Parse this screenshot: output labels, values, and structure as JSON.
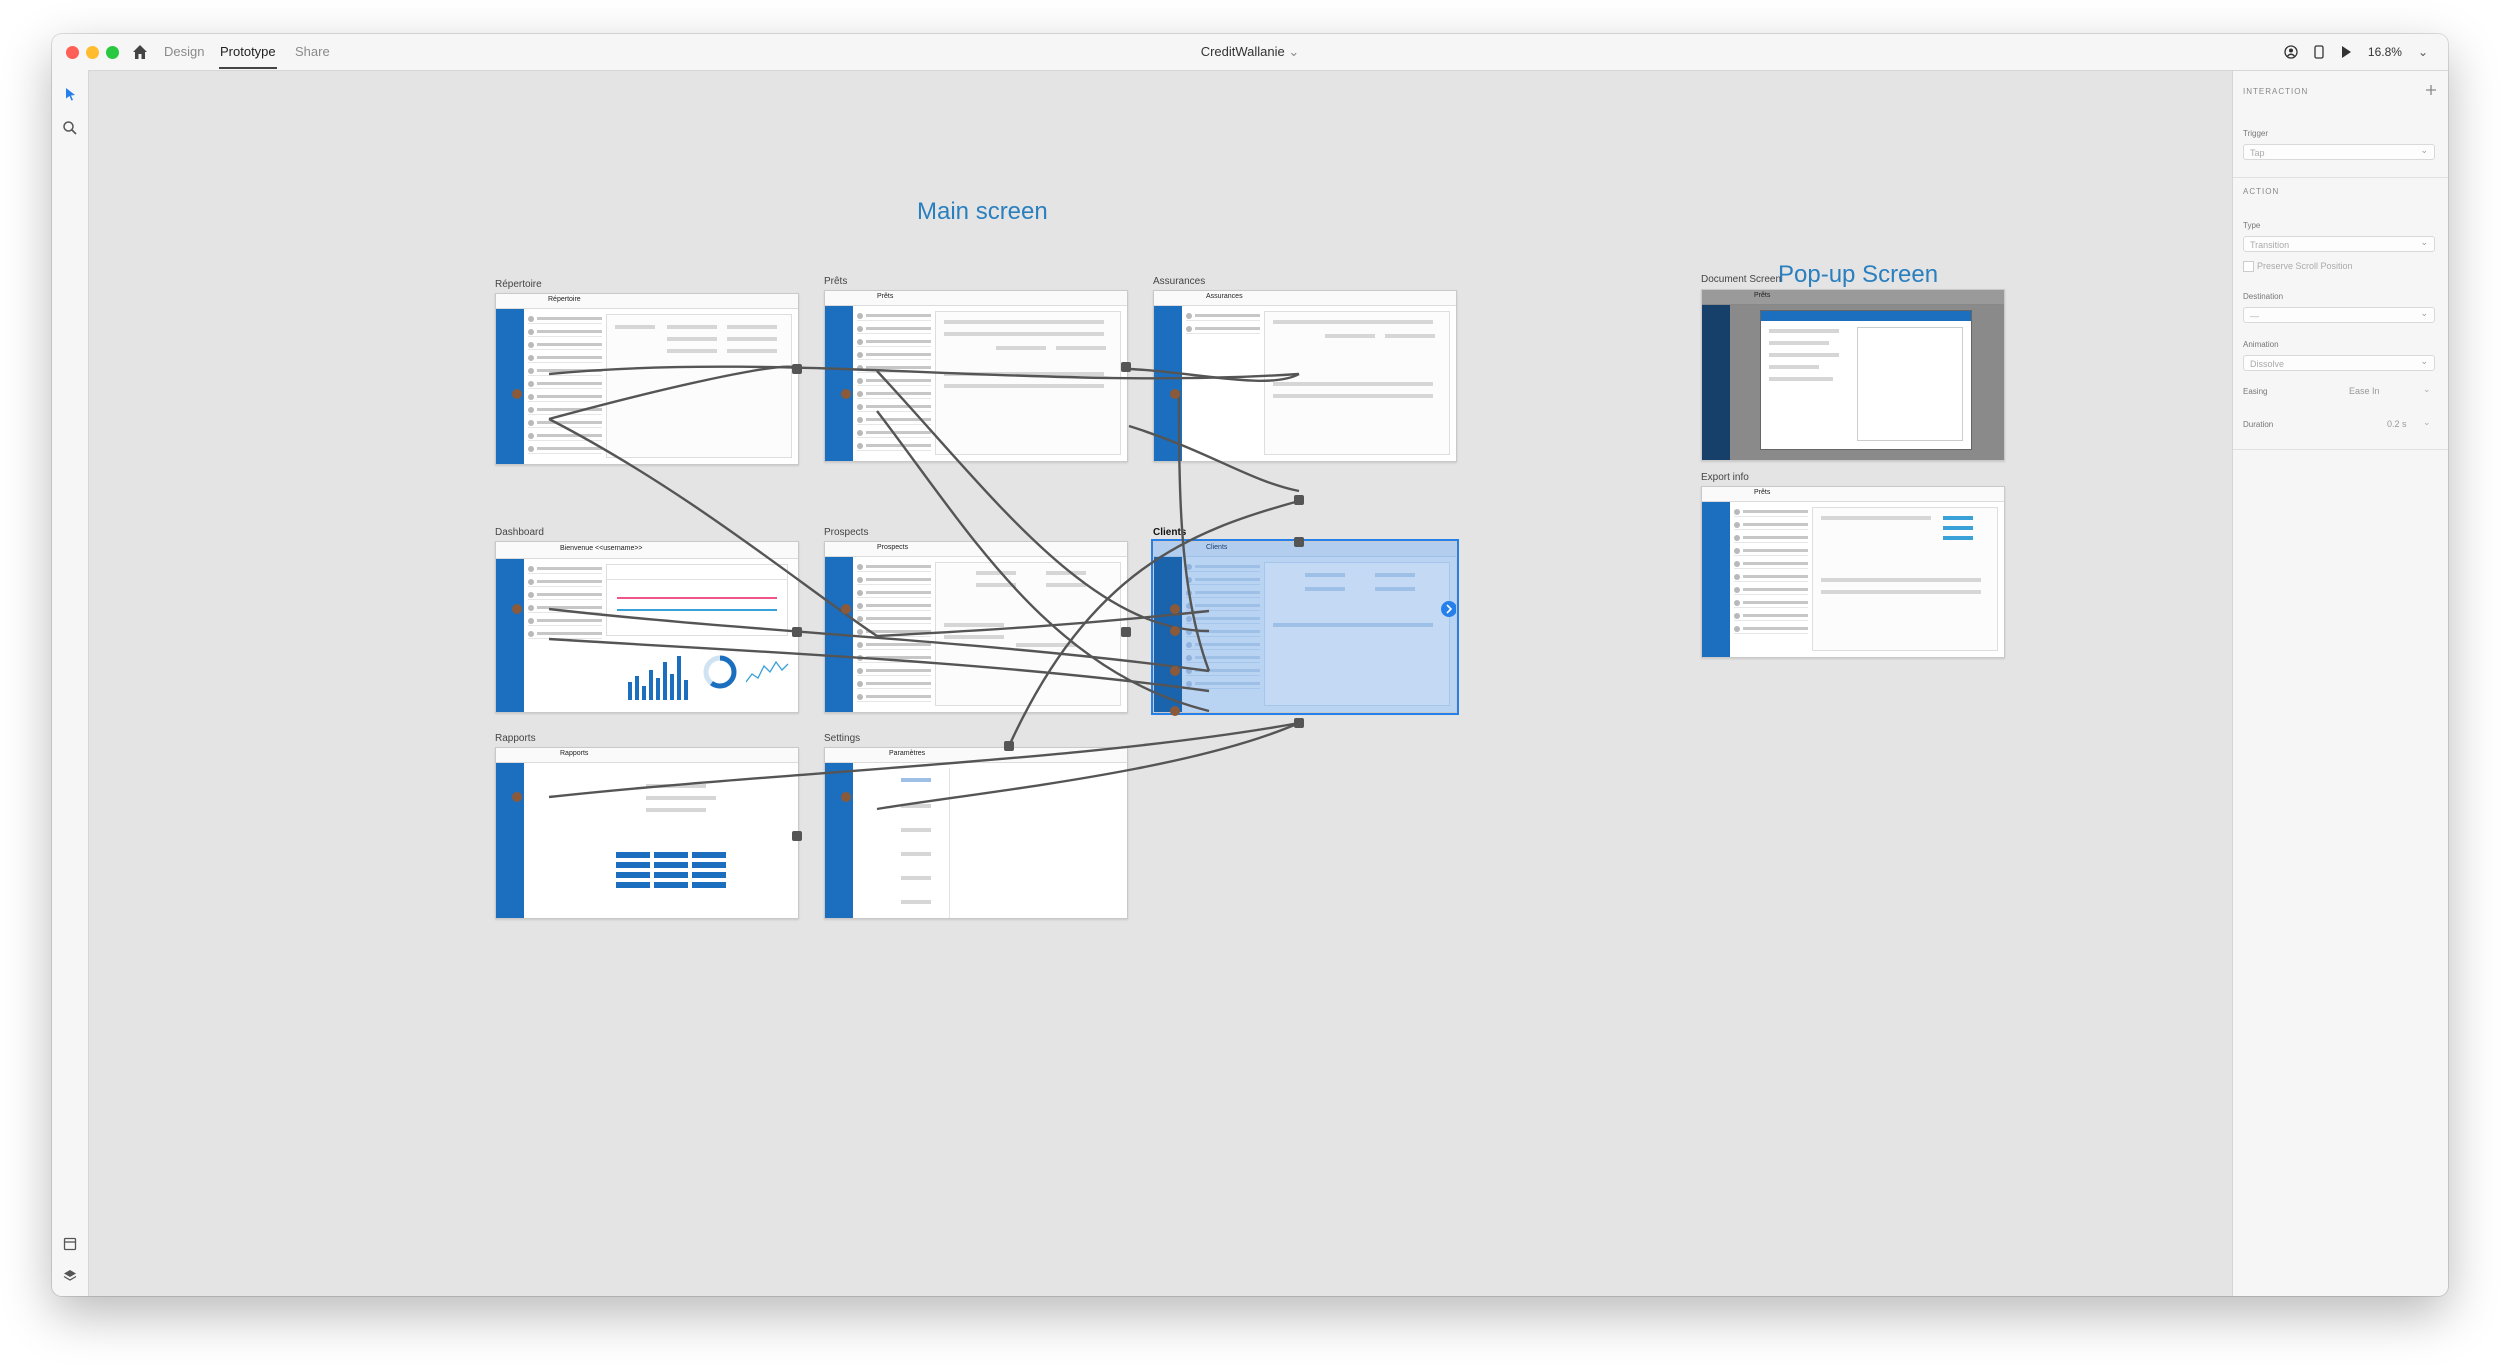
{
  "app": {
    "document_title": "CreditWallanie",
    "modes": [
      "Design",
      "Prototype",
      "Share"
    ],
    "active_mode": "Prototype",
    "zoom": "16.8%"
  },
  "canvas": {
    "sections": {
      "main": "Main screen",
      "popup": "Pop-up Screen"
    },
    "artboards": {
      "repertoire": {
        "label": "Répertoire",
        "title": "Répertoire"
      },
      "prets": {
        "label": "Prêts",
        "title": "Prêts"
      },
      "assurances": {
        "label": "Assurances",
        "title": "Assurances"
      },
      "dashboard": {
        "label": "Dashboard",
        "title": "Bienvenue <<username>>"
      },
      "prospects": {
        "label": "Prospects",
        "title": "Prospects"
      },
      "clients": {
        "label": "Clients",
        "title": "Clients"
      },
      "rapports": {
        "label": "Rapports",
        "title": "Rapports"
      },
      "settings": {
        "label": "Settings",
        "title": "Paramètres"
      },
      "document": {
        "label": "Document Screen",
        "title": "Prêts"
      },
      "export": {
        "label": "Export info",
        "title": "Prêts"
      }
    }
  },
  "inspector": {
    "heading": "INTERACTION",
    "trigger_label": "Trigger",
    "trigger_value": "Tap",
    "action_heading": "ACTION",
    "type_label": "Type",
    "type_value": "Transition",
    "preserve_scroll": "Preserve Scroll Position",
    "destination_label": "Destination",
    "destination_value": "—",
    "animation_label": "Animation",
    "animation_value": "Dissolve",
    "easing_label": "Easing",
    "easing_value": "Ease In",
    "duration_label": "Duration",
    "duration_value": "0.2 s"
  },
  "colors": {
    "brand_blue": "#1c6fbf",
    "section_title": "#2a7fbf",
    "selection": "#2680eb"
  }
}
